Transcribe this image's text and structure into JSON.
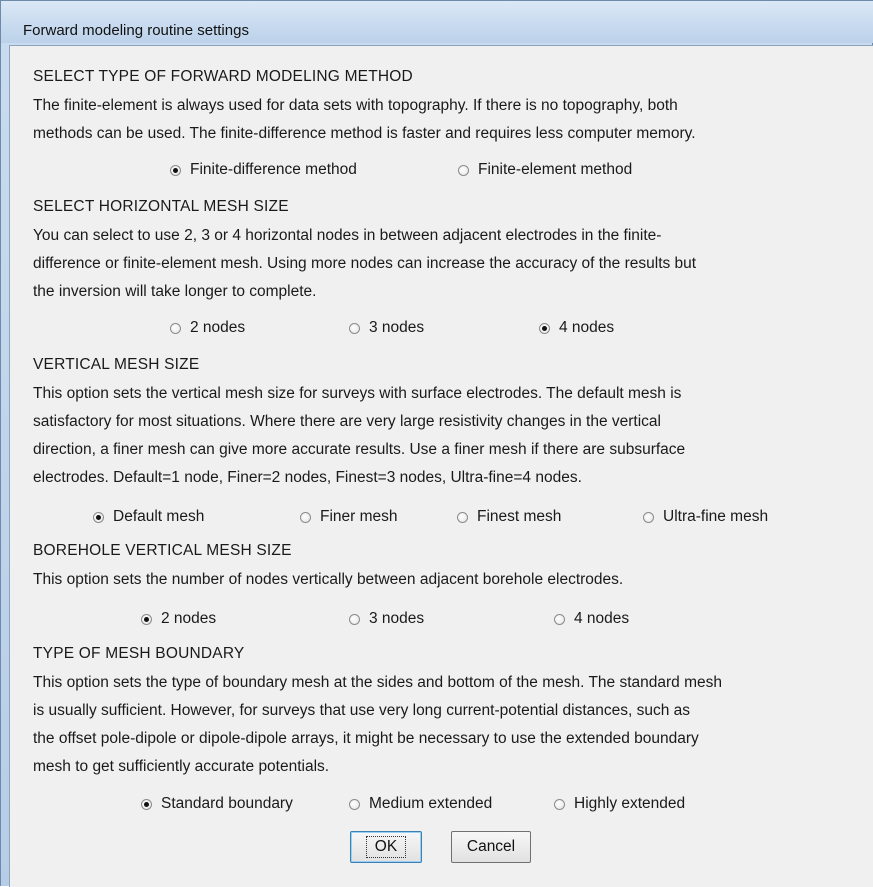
{
  "window": {
    "title": "Forward modeling routine settings"
  },
  "sections": {
    "method": {
      "heading": "SELECT TYPE OF FORWARD MODELING METHOD",
      "lines": [
        "The finite-element is always used for data sets with topography. If there is no topography, both",
        "methods can be used.  The finite-difference method is faster and requires less computer memory."
      ],
      "options": [
        "Finite-difference method",
        "Finite-element method"
      ],
      "selected": "Finite-difference method"
    },
    "horizontal": {
      "heading": "SELECT HORIZONTAL MESH SIZE",
      "lines": [
        "You can select to use 2, 3 or 4 horizontal nodes in between adjacent electrodes in the finite-",
        "difference or finite-element mesh. Using more nodes can increase the accuracy of the results but",
        "the inversion will take longer to complete."
      ],
      "options": [
        "2 nodes",
        "3 nodes",
        "4 nodes"
      ],
      "selected": "4 nodes"
    },
    "vertical": {
      "heading": "VERTICAL MESH SIZE",
      "lines": [
        "This option sets the vertical mesh size for surveys with surface electrodes. The default mesh is",
        "satisfactory for most situations. Where there are very large resistivity changes in the vertical",
        "direction, a finer mesh can give more accurate results. Use a finer mesh if there are subsurface",
        "electrodes. Default=1 node, Finer=2 nodes, Finest=3 nodes, Ultra-fine=4 nodes."
      ],
      "options": [
        "Default mesh",
        "Finer mesh",
        "Finest mesh",
        "Ultra-fine mesh"
      ],
      "selected": "Default mesh"
    },
    "borehole": {
      "heading": "BOREHOLE VERTICAL MESH SIZE",
      "lines": [
        "This option sets the number of nodes vertically between adjacent borehole electrodes."
      ],
      "options": [
        "2 nodes",
        "3 nodes",
        "4 nodes"
      ],
      "selected": "2 nodes"
    },
    "boundary": {
      "heading": "TYPE OF MESH BOUNDARY",
      "lines": [
        "This option sets the type of boundary mesh at the sides and bottom of the mesh. The standard mesh",
        "is usually sufficient. However, for surveys that use very long current-potential distances, such as",
        "the offset pole-dipole or dipole-dipole arrays, it might be  necessary to use the extended boundary",
        "mesh to get sufficiently accurate potentials."
      ],
      "options": [
        "Standard boundary",
        "Medium extended",
        "Highly extended"
      ],
      "selected": "Standard boundary"
    }
  },
  "buttons": {
    "ok": "OK",
    "cancel": "Cancel"
  }
}
